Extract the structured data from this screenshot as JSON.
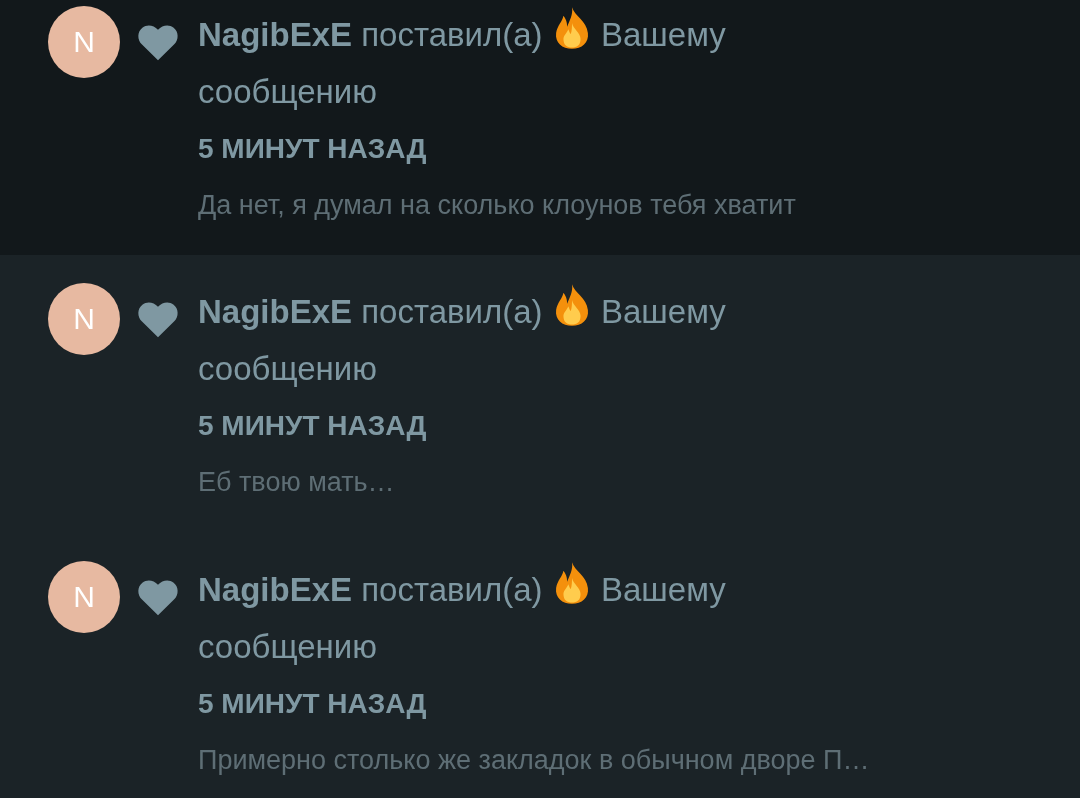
{
  "notifications": [
    {
      "unread": true,
      "avatar_letter": "N",
      "user": "NagibExE",
      "action": "поставил(а)",
      "target": "Вашему сообщению",
      "time": "5 МИНУТ НАЗАД",
      "message": "Да нет, я думал на сколько клоунов тебя хватит"
    },
    {
      "unread": false,
      "avatar_letter": "N",
      "user": "NagibExE",
      "action": "поставил(а)",
      "target": "Вашему сообщению",
      "time": "5 МИНУТ НАЗАД",
      "message": "Еб твою мать…"
    },
    {
      "unread": false,
      "avatar_letter": "N",
      "user": "NagibExE",
      "action": "поставил(а)",
      "target": "Вашему сообщению",
      "time": "5 МИНУТ НАЗАД",
      "message": "Примерно столько же закладок в обычном дворе П…"
    }
  ]
}
